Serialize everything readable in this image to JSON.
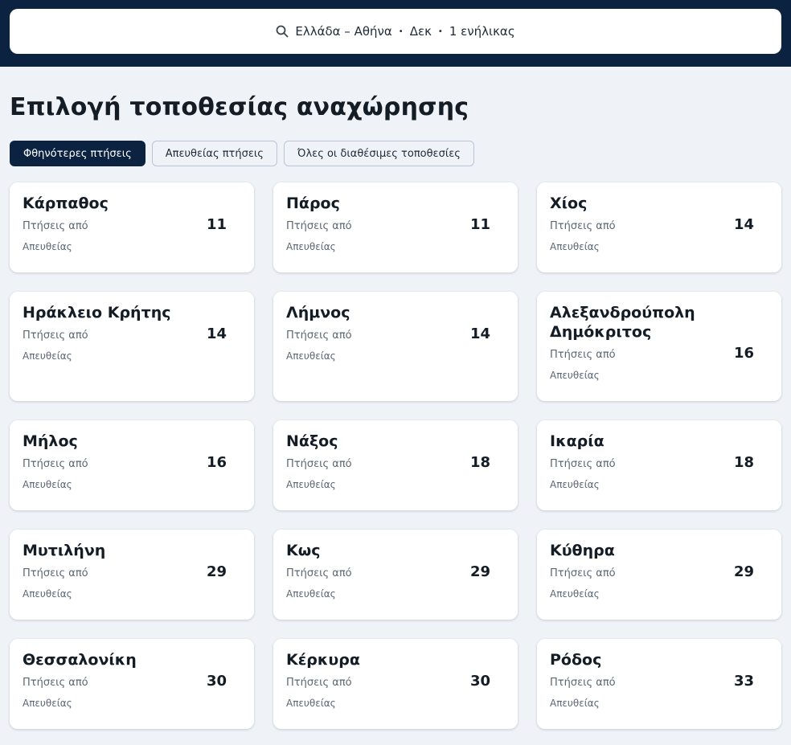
{
  "search": {
    "location": "Ελλάδα – Αθήνα",
    "month": "Δεκ",
    "passengers": "1 ενήλικας",
    "separator": "•"
  },
  "page": {
    "title": "Επιλογή τοποθεσίας αναχώρησης"
  },
  "tabs": [
    {
      "label": "Φθηνότερες πτήσεις",
      "active": true
    },
    {
      "label": "Απευθείας πτήσεις",
      "active": false
    },
    {
      "label": "Όλες οι διαθέσιμες τοποθεσίες",
      "active": false
    }
  ],
  "cards": [
    {
      "city": "Κάρπαθος",
      "from_label": "Πτήσεις από",
      "price": "11",
      "direct_label": "Απευθείας"
    },
    {
      "city": "Πάρος",
      "from_label": "Πτήσεις από",
      "price": "11",
      "direct_label": "Απευθείας"
    },
    {
      "city": "Χίος",
      "from_label": "Πτήσεις από",
      "price": "14",
      "direct_label": "Απευθείας"
    },
    {
      "city": "Ηράκλειο Κρήτης",
      "from_label": "Πτήσεις από",
      "price": "14",
      "direct_label": "Απευθείας"
    },
    {
      "city": "Λήμνος",
      "from_label": "Πτήσεις από",
      "price": "14",
      "direct_label": "Απευθείας"
    },
    {
      "city": "Αλεξανδρούπολη Δημόκριτος",
      "from_label": "Πτήσεις από",
      "price": "16",
      "direct_label": "Απευθείας"
    },
    {
      "city": "Μήλος",
      "from_label": "Πτήσεις από",
      "price": "16",
      "direct_label": "Απευθείας"
    },
    {
      "city": "Νάξος",
      "from_label": "Πτήσεις από",
      "price": "18",
      "direct_label": "Απευθείας"
    },
    {
      "city": "Ικαρία",
      "from_label": "Πτήσεις από",
      "price": "18",
      "direct_label": "Απευθείας"
    },
    {
      "city": "Μυτιλήνη",
      "from_label": "Πτήσεις από",
      "price": "29",
      "direct_label": "Απευθείας"
    },
    {
      "city": "Κως",
      "from_label": "Πτήσεις από",
      "price": "29",
      "direct_label": "Απευθείας"
    },
    {
      "city": "Κύθηρα",
      "from_label": "Πτήσεις από",
      "price": "29",
      "direct_label": "Απευθείας"
    },
    {
      "city": "Θεσσαλονίκη",
      "from_label": "Πτήσεις από",
      "price": "30",
      "direct_label": "Απευθείας"
    },
    {
      "city": "Κέρκυρα",
      "from_label": "Πτήσεις από",
      "price": "30",
      "direct_label": "Απευθείας"
    },
    {
      "city": "Ρόδος",
      "from_label": "Πτήσεις από",
      "price": "33",
      "direct_label": "Απευθείας"
    }
  ],
  "colors": {
    "header_bg": "#0b2340",
    "page_bg": "#eff2f7",
    "active_tab_bg": "#0b2340"
  },
  "icons": {
    "search": "search-icon"
  }
}
